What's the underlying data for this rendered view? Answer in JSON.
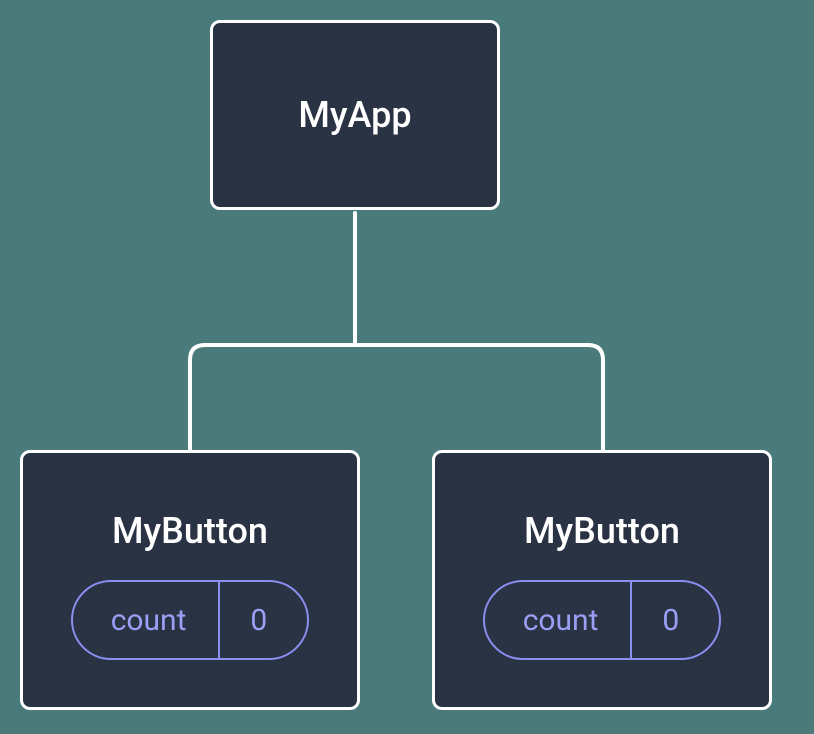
{
  "tree": {
    "root": {
      "label": "MyApp"
    },
    "children": [
      {
        "label": "MyButton",
        "state": {
          "key": "count",
          "value": "0"
        }
      },
      {
        "label": "MyButton",
        "state": {
          "key": "count",
          "value": "0"
        }
      }
    ]
  },
  "colors": {
    "node_bg": "#2a3344",
    "node_border": "#ffffff",
    "pill_border": "#8a8ff0",
    "text": "#ffffff",
    "pill_text": "#9a9ff5",
    "canvas_bg": "#4a7a7a"
  }
}
